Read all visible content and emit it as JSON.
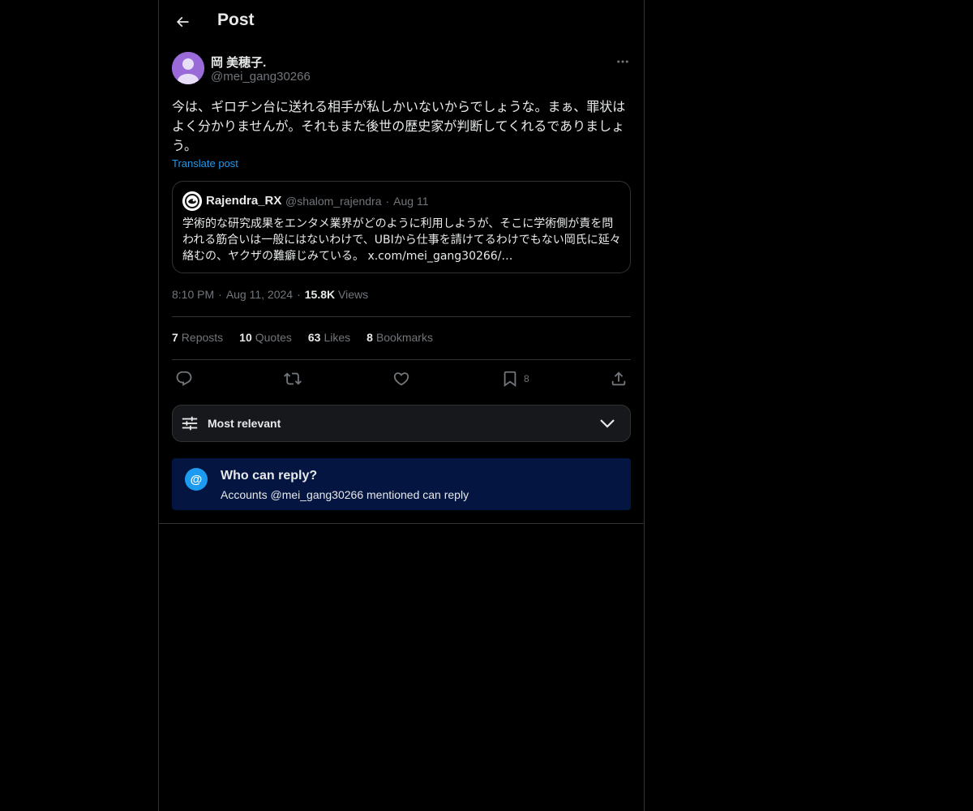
{
  "header": {
    "title": "Post",
    "back_icon": "arrow-left-icon"
  },
  "post": {
    "author_name": "岡 美穂子.",
    "author_handle": "@mei_gang30266",
    "text": "今は、ギロチン台に送れる相手が私しかいないからでしょうな。まぁ、罪状はよく分かりませんが。それもまた後世の歴史家が判断してくれるでありましょう。",
    "translate_label": "Translate post",
    "time": "8:10 PM",
    "date": "Aug 11, 2024",
    "views_count": "15.8K",
    "views_label": "Views"
  },
  "quote": {
    "author_name": "Rajendra_RX",
    "author_handle": "@shalom_rajendra",
    "date": "Aug 11",
    "text": "学術的な研究成果をエンタメ業界がどのように利用しようが、そこに学術側が責を問われる筋合いは一般にはないわけで、UBIから仕事を請けてるわけでもない岡氏に延々絡むの、ヤクザの難癖じみている。 x.com/mei_gang30266/…"
  },
  "stats": {
    "reposts_count": "7",
    "reposts_label": "Reposts",
    "quotes_count": "10",
    "quotes_label": "Quotes",
    "likes_count": "63",
    "likes_label": "Likes",
    "bookmarks_count": "8",
    "bookmarks_label": "Bookmarks"
  },
  "actions": {
    "reply_icon": "reply-icon",
    "repost_icon": "repost-icon",
    "like_icon": "heart-icon",
    "bookmark_icon": "bookmark-icon",
    "bookmark_count": "8",
    "share_icon": "share-icon"
  },
  "sort": {
    "label": "Most relevant"
  },
  "reply_settings": {
    "title": "Who can reply?",
    "subtitle": "Accounts @mei_gang30266 mentioned can reply",
    "icon_glyph": "@"
  },
  "colors": {
    "background": "#000000",
    "text": "#e7e9ea",
    "secondary_text": "#71767b",
    "accent": "#1d9bf0",
    "border": "#2f3336",
    "reply_box_bg": "#031540"
  }
}
